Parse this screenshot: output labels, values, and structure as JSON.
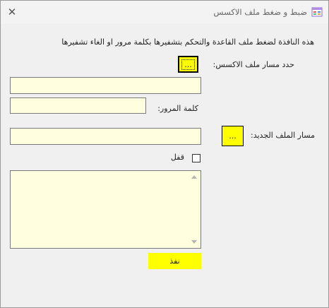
{
  "window": {
    "title": "ضبط و ضغط ملف الاكسس",
    "close_glyph": "✕"
  },
  "description": "هذه النافذة لضغط ملف القاعدة والتحكم بتشفيرها بكلمة مرور او الغاء تشفيرها",
  "source": {
    "label": "حدد مسار ملف الاكسس:",
    "browse_label": "...",
    "path_value": ""
  },
  "password": {
    "label": "كلمة المرور:",
    "value": ""
  },
  "target": {
    "label": "مسار الملف الجديد:",
    "browse_label": "...",
    "path_value": ""
  },
  "lock": {
    "label": "قفل",
    "checked": false
  },
  "log": {
    "value": ""
  },
  "execute_label": "نفذ",
  "colors": {
    "accent_yellow": "#ffff00",
    "input_background": "#ffffe0",
    "window_background": "#f0f0f0"
  }
}
